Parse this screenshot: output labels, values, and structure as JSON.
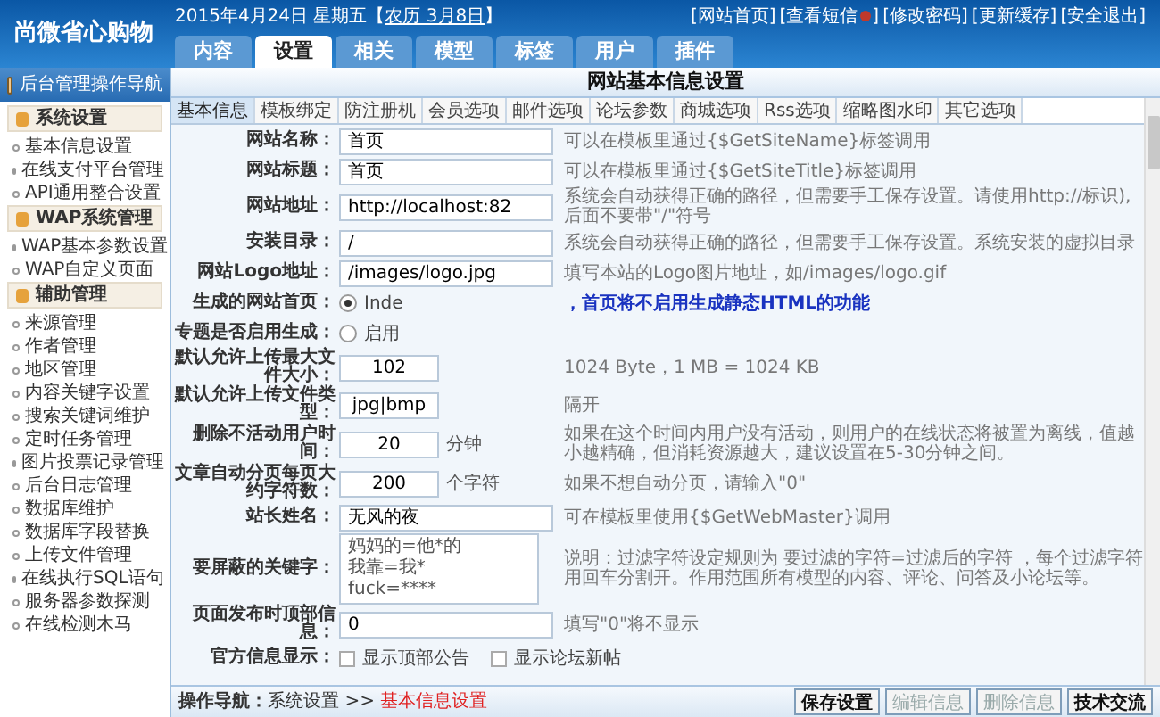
{
  "header": {
    "logo": "尚微省心购物",
    "date": "2015年4月24日 星期五【",
    "lunar": "农历 3月8日",
    "date_end": "】",
    "links": [
      {
        "text": "[网站首页]",
        "icon": false
      },
      {
        "text": "[查看短信",
        "icon": true,
        "close": "]"
      },
      {
        "text": "[修改密码]",
        "icon": false
      },
      {
        "text": "[更新缓存]",
        "icon": false
      },
      {
        "text": "[安全退出]",
        "icon": false
      }
    ],
    "tabs": [
      {
        "label": "内容",
        "selected": false
      },
      {
        "label": "设置",
        "selected": true
      },
      {
        "label": "相关",
        "selected": false
      },
      {
        "label": "模型",
        "selected": false
      },
      {
        "label": "标签",
        "selected": false
      },
      {
        "label": "用户",
        "selected": false
      },
      {
        "label": "插件",
        "selected": false
      }
    ]
  },
  "sidebar": {
    "title": "后台管理操作导航",
    "sections": [
      {
        "title": "系统设置",
        "items": [
          "基本信息设置",
          "在线支付平台管理",
          "API通用整合设置"
        ]
      },
      {
        "title": "WAP系统管理",
        "items": [
          "WAP基本参数设置",
          "WAP自定义页面"
        ]
      },
      {
        "title": "辅助管理",
        "items": [
          "来源管理",
          "作者管理",
          "地区管理",
          "内容关键字设置",
          "搜索关键词维护",
          "定时任务管理",
          "图片投票记录管理",
          "后台日志管理",
          "数据库维护",
          "数据库字段替换",
          "上传文件管理",
          "在线执行SQL语句",
          "服务器参数探测",
          "在线检测木马"
        ]
      }
    ]
  },
  "panel": {
    "title": "网站基本信息设置",
    "tabs": [
      {
        "label": "基本信息",
        "selected": true
      },
      {
        "label": "模板绑定",
        "selected": false
      },
      {
        "label": "防注册机",
        "selected": false
      },
      {
        "label": "会员选项",
        "selected": false
      },
      {
        "label": "邮件选项",
        "selected": false
      },
      {
        "label": "论坛参数",
        "selected": false
      },
      {
        "label": "商城选项",
        "selected": false
      },
      {
        "label": "Rss选项",
        "selected": false
      },
      {
        "label": "缩略图水印",
        "selected": false
      },
      {
        "label": "其它选项",
        "selected": false
      }
    ],
    "rows": [
      {
        "kind": "text",
        "label": "网站名称：",
        "value": "首页",
        "hint": "可以在模板里通过{$GetSiteName}标签调用"
      },
      {
        "kind": "text",
        "label": "网站标题：",
        "value": "首页",
        "hint": "可以在模板里通过{$GetSiteTitle}标签调用"
      },
      {
        "kind": "text",
        "label": "网站地址：",
        "value": "http://localhost:82",
        "hint": "系统会自动获得正确的路径，但需要手工保存设置。请使用http://标识),后面不要带\"/\"符号"
      },
      {
        "kind": "text",
        "label": "安装目录：",
        "value": "/",
        "hint": "系统会自动获得正确的路径，但需要手工保存设置。系统安装的虚拟目录"
      },
      {
        "kind": "text",
        "label": "网站Logo地址：",
        "value": "/images/logo.jpg",
        "hint": "填写本站的Logo图片地址，如/images/logo.gif"
      },
      {
        "kind": "radio",
        "label": "生成的网站首页：",
        "option": "Inde",
        "selected": true,
        "hint": "，首页将不启用生成静态HTML的功能",
        "hint_blue": true
      },
      {
        "kind": "radio",
        "label": "专题是否启用生成：",
        "option": "启用",
        "selected": false
      },
      {
        "kind": "short",
        "label": "默认允许上传最大文件大小：",
        "value": "102",
        "hint": "1024 Byte，1 MB = 1024 KB"
      },
      {
        "kind": "short",
        "label": "默认允许上传文件类型：",
        "value": "jpg|bmp",
        "hint": "隔开"
      },
      {
        "kind": "short",
        "label": "删除不活动用户时间：",
        "value": "20",
        "unit": "分钟",
        "hint": "如果在这个时间内用户没有活动，则用户的在线状态将被置为离线，值越小越精确，但消耗资源越大，建议设置在5-30分钟之间。"
      },
      {
        "kind": "short",
        "label": "文章自动分页每页大约字符数：",
        "value": "200",
        "unit": "个字符",
        "hint": "如果不想自动分页，请输入\"0\""
      },
      {
        "kind": "text",
        "label": "站长姓名：",
        "value": "无风的夜",
        "hint": "可在模板里使用{$GetWebMaster}调用"
      },
      {
        "kind": "textarea",
        "label": "要屏蔽的关键字：",
        "lines": [
          "妈妈的=他*的",
          "我靠=我*",
          "fuck=****"
        ],
        "hint": "说明：过滤字符设定规则为 要过滤的字符=过滤后的字符 ，每个过滤字符用回车分割开。作用范围所有模型的内容、评论、问答及小论坛等。"
      },
      {
        "kind": "text",
        "label": "页面发布时顶部信息：",
        "value": "0",
        "hint": "填写\"0\"将不显示"
      },
      {
        "kind": "checks",
        "label": "官方信息显示：",
        "options": [
          {
            "label": "显示顶部公告",
            "checked": false
          },
          {
            "label": "显示论坛新帖",
            "checked": false
          }
        ]
      }
    ]
  },
  "footer": {
    "nav_label": "操作导航：",
    "crumb": "系统设置",
    "sep": ">>",
    "current": "基本信息设置",
    "buttons": [
      {
        "label": "保存设置",
        "disabled": false
      },
      {
        "label": "编辑信息",
        "disabled": true
      },
      {
        "label": "删除信息",
        "disabled": true
      },
      {
        "label": "技术交流",
        "disabled": false
      }
    ]
  }
}
